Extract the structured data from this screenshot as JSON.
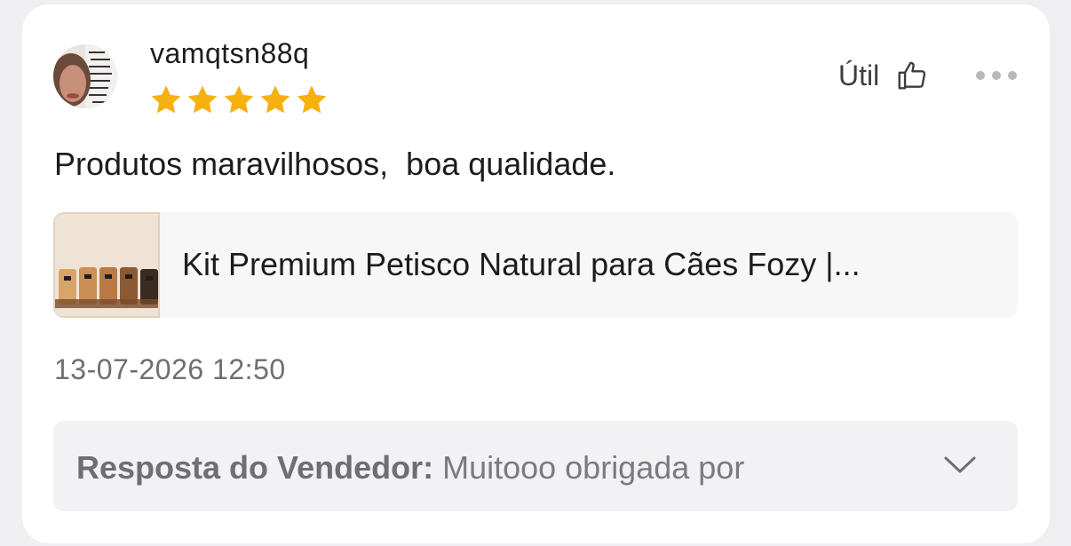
{
  "review": {
    "username": "vamqtsn88q",
    "rating": 5,
    "text": "Produtos maravilhosos,  boa qualidade.",
    "helpful_label": "Útil",
    "date": "13-07-2026 12:50"
  },
  "product": {
    "title": "Kit Premium Petisco Natural para Cães Fozy |..."
  },
  "seller_reply": {
    "label": "Resposta do Vendedor:",
    "message": " Muitooo obrigada por"
  },
  "colors": {
    "star": "#f7b10f",
    "text": "#1c1c1e",
    "muted": "#6e6e73"
  },
  "icons": {
    "helpful": "thumbs-up-icon",
    "more": "more-dots-icon",
    "expand": "chevron-down-icon"
  }
}
